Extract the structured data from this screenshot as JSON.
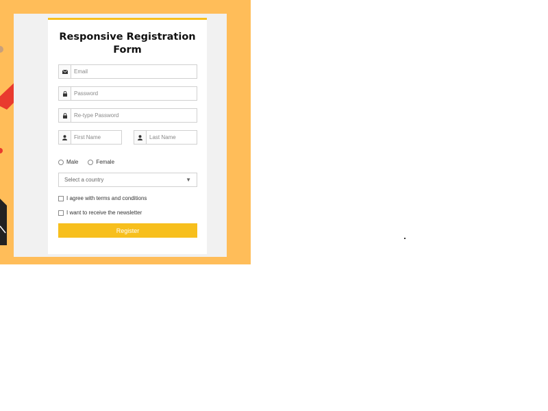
{
  "form": {
    "title": "Responsive Registration Form",
    "email_placeholder": "Email",
    "password_placeholder": "Password",
    "retype_password_placeholder": "Re-type Password",
    "first_name_placeholder": "First Name",
    "last_name_placeholder": "Last Name",
    "gender_options": [
      "Male",
      "Female"
    ],
    "country_placeholder": "Select a country",
    "terms_label": "I agree with terms and conditions",
    "newsletter_label": "I want to receive the newsletter",
    "register_label": "Register"
  },
  "icons": {
    "email": "envelope-icon",
    "password": "lock-icon",
    "retype_password": "lock-icon",
    "first_name": "user-icon",
    "last_name": "user-icon",
    "select_arrow": "chevron-down-icon"
  },
  "colors": {
    "background": "#ffbd59",
    "accent": "#f7bf1d",
    "panel": "#f1f1f1"
  }
}
